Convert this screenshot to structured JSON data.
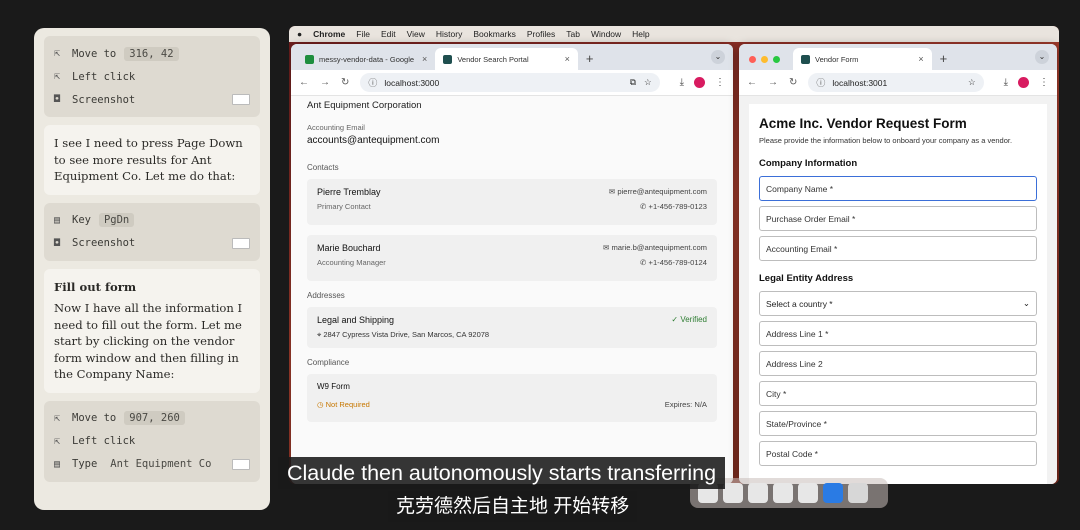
{
  "agent": {
    "card1": [
      {
        "icon": "cursor-icon",
        "label": "Move to",
        "arg": "316, 42"
      },
      {
        "icon": "cursor-icon",
        "label": "Left click",
        "arg": ""
      },
      {
        "icon": "camera-icon",
        "label": "Screenshot",
        "arg": ""
      }
    ],
    "thought1": "I see I need to press Page Down to see more results for Ant Equipment Co. Let me do that:",
    "card2": [
      {
        "icon": "keyboard-icon",
        "label": "Key",
        "arg": "PgDn"
      },
      {
        "icon": "camera-icon",
        "label": "Screenshot",
        "arg": ""
      }
    ],
    "thought2_title": "Fill out form",
    "thought2": "Now I have all the information I need to fill out the form. Let me start by clicking on the vendor form window and then filling in the Company Name:",
    "card3": [
      {
        "icon": "cursor-icon",
        "label": "Move to",
        "arg": "907, 260"
      },
      {
        "icon": "cursor-icon",
        "label": "Left click",
        "arg": ""
      },
      {
        "icon": "keyboard-icon",
        "label": "Type",
        "arg": "Ant Equipment Co"
      }
    ]
  },
  "menubar": {
    "apple": "",
    "app": "Chrome",
    "items": [
      "File",
      "Edit",
      "View",
      "History",
      "Bookmarks",
      "Profiles",
      "Tab",
      "Window",
      "Help"
    ]
  },
  "browser1": {
    "tabs": [
      {
        "label": "messy-vendor-data - Google",
        "close": "×"
      },
      {
        "label": "Vendor Search Portal",
        "close": "×"
      }
    ],
    "url": "localhost:3000",
    "company": "Ant Equipment Corporation",
    "email_label": "Accounting Email",
    "email": "accounts@antequipment.com",
    "contacts_label": "Contacts",
    "contacts": [
      {
        "name": "Pierre Tremblay",
        "role": "Primary Contact",
        "email": "pierre@antequipment.com",
        "phone": "+1-456-789-0123"
      },
      {
        "name": "Marie Bouchard",
        "role": "Accounting Manager",
        "email": "marie.b@antequipment.com",
        "phone": "+1-456-789-0124"
      }
    ],
    "addresses_label": "Addresses",
    "address": {
      "title": "Legal and Shipping",
      "status": "Verified",
      "line": "2847 Cypress Vista Drive, San Marcos, CA 92078"
    },
    "compliance_label": "Compliance",
    "compliance": {
      "title": "W9 Form",
      "status": "Not Required",
      "expires": "Expires: N/A"
    }
  },
  "browser2": {
    "tabs": [
      {
        "label": "Vendor Form",
        "close": "×"
      }
    ],
    "url": "localhost:3001",
    "title": "Acme Inc. Vendor Request Form",
    "desc": "Please provide the information below to onboard your company as a vendor.",
    "company_section": "Company Information",
    "fields1": [
      "Company Name *",
      "Purchase Order Email *",
      "Accounting Email *"
    ],
    "address_section": "Legal Entity Address",
    "country_select": "Select a country *",
    "fields2": [
      "Address Line 1 *",
      "Address Line 2",
      "City *",
      "State/Province *",
      "Postal Code *"
    ]
  },
  "subtitles": {
    "en": "Claude then autonomously starts transferring",
    "zh": "克劳德然后自主地 开始转移"
  },
  "colors": {
    "focus": "#3b6fd8",
    "verified": "#2e7d32",
    "warning": "#c77700",
    "profile": "#d81b60"
  }
}
